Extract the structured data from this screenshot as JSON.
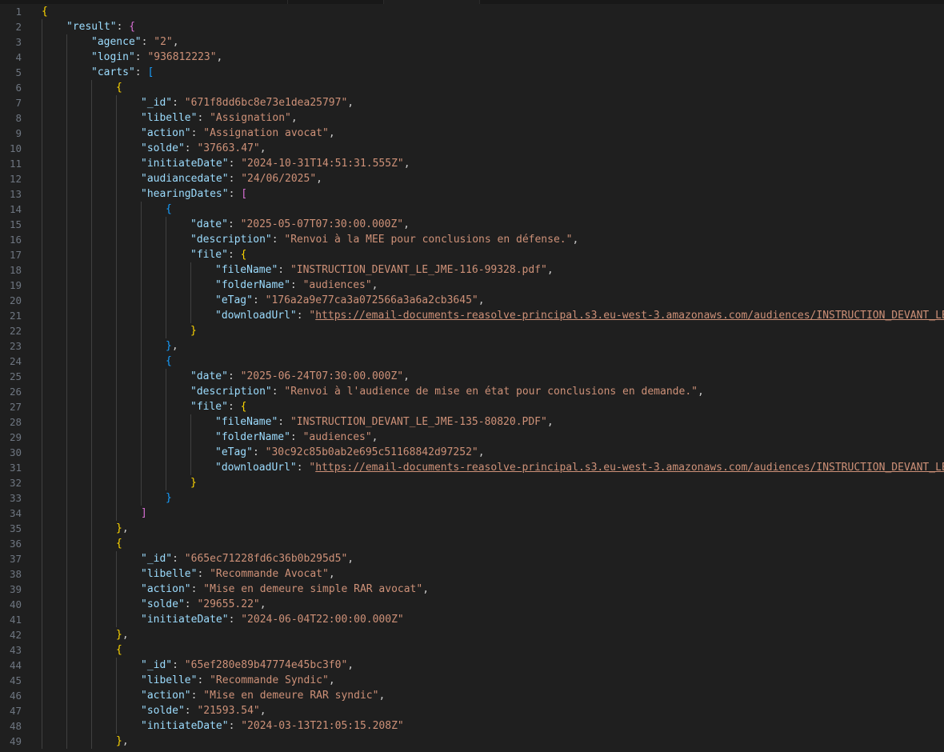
{
  "editor": {
    "language": "json",
    "colors": {
      "background": "#1f1f1f",
      "key": "#9cdcfe",
      "string": "#ce9178",
      "punctuation": "#cccccc",
      "line_number": "#6e7681",
      "bracket_level_1": "#ffd700",
      "bracket_level_2": "#da70d6",
      "bracket_level_3": "#179fff"
    },
    "lines": [
      {
        "n": "1",
        "d": 0,
        "t": [
          [
            "b1",
            "{"
          ]
        ]
      },
      {
        "n": "2",
        "d": 1,
        "t": [
          [
            "k",
            "\"result\""
          ],
          [
            "p",
            ": "
          ],
          [
            "b2",
            "{"
          ]
        ]
      },
      {
        "n": "3",
        "d": 2,
        "t": [
          [
            "k",
            "\"agence\""
          ],
          [
            "p",
            ": "
          ],
          [
            "s",
            "\"2\""
          ],
          [
            "p",
            ","
          ]
        ]
      },
      {
        "n": "4",
        "d": 2,
        "t": [
          [
            "k",
            "\"login\""
          ],
          [
            "p",
            ": "
          ],
          [
            "s",
            "\"936812223\""
          ],
          [
            "p",
            ","
          ]
        ]
      },
      {
        "n": "5",
        "d": 2,
        "t": [
          [
            "k",
            "\"carts\""
          ],
          [
            "p",
            ": "
          ],
          [
            "b3",
            "["
          ]
        ]
      },
      {
        "n": "6",
        "d": 3,
        "t": [
          [
            "b1",
            "{"
          ]
        ]
      },
      {
        "n": "7",
        "d": 4,
        "t": [
          [
            "k",
            "\"_id\""
          ],
          [
            "p",
            ": "
          ],
          [
            "s",
            "\"671f8dd6bc8e73e1dea25797\""
          ],
          [
            "p",
            ","
          ]
        ]
      },
      {
        "n": "8",
        "d": 4,
        "t": [
          [
            "k",
            "\"libelle\""
          ],
          [
            "p",
            ": "
          ],
          [
            "s",
            "\"Assignation\""
          ],
          [
            "p",
            ","
          ]
        ]
      },
      {
        "n": "9",
        "d": 4,
        "t": [
          [
            "k",
            "\"action\""
          ],
          [
            "p",
            ": "
          ],
          [
            "s",
            "\"Assignation avocat\""
          ],
          [
            "p",
            ","
          ]
        ]
      },
      {
        "n": "10",
        "d": 4,
        "t": [
          [
            "k",
            "\"solde\""
          ],
          [
            "p",
            ": "
          ],
          [
            "s",
            "\"37663.47\""
          ],
          [
            "p",
            ","
          ]
        ]
      },
      {
        "n": "11",
        "d": 4,
        "t": [
          [
            "k",
            "\"initiateDate\""
          ],
          [
            "p",
            ": "
          ],
          [
            "s",
            "\"2024-10-31T14:51:31.555Z\""
          ],
          [
            "p",
            ","
          ]
        ]
      },
      {
        "n": "12",
        "d": 4,
        "t": [
          [
            "k",
            "\"audiancedate\""
          ],
          [
            "p",
            ": "
          ],
          [
            "s",
            "\"24/06/2025\""
          ],
          [
            "p",
            ","
          ]
        ]
      },
      {
        "n": "13",
        "d": 4,
        "t": [
          [
            "k",
            "\"hearingDates\""
          ],
          [
            "p",
            ": "
          ],
          [
            "b2",
            "["
          ]
        ]
      },
      {
        "n": "14",
        "d": 5,
        "t": [
          [
            "b3",
            "{"
          ]
        ]
      },
      {
        "n": "15",
        "d": 6,
        "t": [
          [
            "k",
            "\"date\""
          ],
          [
            "p",
            ": "
          ],
          [
            "s",
            "\"2025-05-07T07:30:00.000Z\""
          ],
          [
            "p",
            ","
          ]
        ]
      },
      {
        "n": "16",
        "d": 6,
        "t": [
          [
            "k",
            "\"description\""
          ],
          [
            "p",
            ": "
          ],
          [
            "s",
            "\"Renvoi à la MEE pour conclusions en défense.\""
          ],
          [
            "p",
            ","
          ]
        ]
      },
      {
        "n": "17",
        "d": 6,
        "t": [
          [
            "k",
            "\"file\""
          ],
          [
            "p",
            ": "
          ],
          [
            "b1",
            "{"
          ]
        ]
      },
      {
        "n": "18",
        "d": 7,
        "t": [
          [
            "k",
            "\"fileName\""
          ],
          [
            "p",
            ": "
          ],
          [
            "s",
            "\"INSTRUCTION_DEVANT_LE_JME-116-99328.pdf\""
          ],
          [
            "p",
            ","
          ]
        ]
      },
      {
        "n": "19",
        "d": 7,
        "t": [
          [
            "k",
            "\"folderName\""
          ],
          [
            "p",
            ": "
          ],
          [
            "s",
            "\"audiences\""
          ],
          [
            "p",
            ","
          ]
        ]
      },
      {
        "n": "20",
        "d": 7,
        "t": [
          [
            "k",
            "\"eTag\""
          ],
          [
            "p",
            ": "
          ],
          [
            "s",
            "\"176a2a9e77ca3a072566a3a6a2cb3645\""
          ],
          [
            "p",
            ","
          ]
        ]
      },
      {
        "n": "21",
        "d": 7,
        "t": [
          [
            "k",
            "\"downloadUrl\""
          ],
          [
            "p",
            ": "
          ],
          [
            "s",
            "\""
          ],
          [
            "u",
            "https://email-documents-reasolve-principal.s3.eu-west-3.amazonaws.com/audiences/INSTRUCTION_DEVANT_LE_J"
          ]
        ]
      },
      {
        "n": "22",
        "d": 6,
        "t": [
          [
            "b1",
            "}"
          ]
        ]
      },
      {
        "n": "23",
        "d": 5,
        "t": [
          [
            "b3",
            "}"
          ],
          [
            "p",
            ","
          ]
        ]
      },
      {
        "n": "24",
        "d": 5,
        "t": [
          [
            "b3",
            "{"
          ]
        ]
      },
      {
        "n": "25",
        "d": 6,
        "t": [
          [
            "k",
            "\"date\""
          ],
          [
            "p",
            ": "
          ],
          [
            "s",
            "\"2025-06-24T07:30:00.000Z\""
          ],
          [
            "p",
            ","
          ]
        ]
      },
      {
        "n": "26",
        "d": 6,
        "t": [
          [
            "k",
            "\"description\""
          ],
          [
            "p",
            ": "
          ],
          [
            "s",
            "\"Renvoi à l'audience de mise en état pour conclusions en demande.\""
          ],
          [
            "p",
            ","
          ]
        ]
      },
      {
        "n": "27",
        "d": 6,
        "t": [
          [
            "k",
            "\"file\""
          ],
          [
            "p",
            ": "
          ],
          [
            "b1",
            "{"
          ]
        ]
      },
      {
        "n": "28",
        "d": 7,
        "t": [
          [
            "k",
            "\"fileName\""
          ],
          [
            "p",
            ": "
          ],
          [
            "s",
            "\"INSTRUCTION_DEVANT_LE_JME-135-80820.PDF\""
          ],
          [
            "p",
            ","
          ]
        ]
      },
      {
        "n": "29",
        "d": 7,
        "t": [
          [
            "k",
            "\"folderName\""
          ],
          [
            "p",
            ": "
          ],
          [
            "s",
            "\"audiences\""
          ],
          [
            "p",
            ","
          ]
        ]
      },
      {
        "n": "30",
        "d": 7,
        "t": [
          [
            "k",
            "\"eTag\""
          ],
          [
            "p",
            ": "
          ],
          [
            "s",
            "\"30c92c85b0ab2e695c51168842d97252\""
          ],
          [
            "p",
            ","
          ]
        ]
      },
      {
        "n": "31",
        "d": 7,
        "t": [
          [
            "k",
            "\"downloadUrl\""
          ],
          [
            "p",
            ": "
          ],
          [
            "s",
            "\""
          ],
          [
            "u",
            "https://email-documents-reasolve-principal.s3.eu-west-3.amazonaws.com/audiences/INSTRUCTION_DEVANT_LE_J"
          ]
        ]
      },
      {
        "n": "32",
        "d": 6,
        "t": [
          [
            "b1",
            "}"
          ]
        ]
      },
      {
        "n": "33",
        "d": 5,
        "t": [
          [
            "b3",
            "}"
          ]
        ]
      },
      {
        "n": "34",
        "d": 4,
        "t": [
          [
            "b2",
            "]"
          ]
        ]
      },
      {
        "n": "35",
        "d": 3,
        "t": [
          [
            "b1",
            "}"
          ],
          [
            "p",
            ","
          ]
        ]
      },
      {
        "n": "36",
        "d": 3,
        "t": [
          [
            "b1",
            "{"
          ]
        ]
      },
      {
        "n": "37",
        "d": 4,
        "t": [
          [
            "k",
            "\"_id\""
          ],
          [
            "p",
            ": "
          ],
          [
            "s",
            "\"665ec71228fd6c36b0b295d5\""
          ],
          [
            "p",
            ","
          ]
        ]
      },
      {
        "n": "38",
        "d": 4,
        "t": [
          [
            "k",
            "\"libelle\""
          ],
          [
            "p",
            ": "
          ],
          [
            "s",
            "\"Recommande Avocat\""
          ],
          [
            "p",
            ","
          ]
        ]
      },
      {
        "n": "39",
        "d": 4,
        "t": [
          [
            "k",
            "\"action\""
          ],
          [
            "p",
            ": "
          ],
          [
            "s",
            "\"Mise en demeure simple RAR avocat\""
          ],
          [
            "p",
            ","
          ]
        ]
      },
      {
        "n": "40",
        "d": 4,
        "t": [
          [
            "k",
            "\"solde\""
          ],
          [
            "p",
            ": "
          ],
          [
            "s",
            "\"29655.22\""
          ],
          [
            "p",
            ","
          ]
        ]
      },
      {
        "n": "41",
        "d": 4,
        "t": [
          [
            "k",
            "\"initiateDate\""
          ],
          [
            "p",
            ": "
          ],
          [
            "s",
            "\"2024-06-04T22:00:00.000Z\""
          ]
        ]
      },
      {
        "n": "42",
        "d": 3,
        "t": [
          [
            "b1",
            "}"
          ],
          [
            "p",
            ","
          ]
        ]
      },
      {
        "n": "43",
        "d": 3,
        "t": [
          [
            "b1",
            "{"
          ]
        ]
      },
      {
        "n": "44",
        "d": 4,
        "t": [
          [
            "k",
            "\"_id\""
          ],
          [
            "p",
            ": "
          ],
          [
            "s",
            "\"65ef280e89b47774e45bc3f0\""
          ],
          [
            "p",
            ","
          ]
        ]
      },
      {
        "n": "45",
        "d": 4,
        "t": [
          [
            "k",
            "\"libelle\""
          ],
          [
            "p",
            ": "
          ],
          [
            "s",
            "\"Recommande Syndic\""
          ],
          [
            "p",
            ","
          ]
        ]
      },
      {
        "n": "46",
        "d": 4,
        "t": [
          [
            "k",
            "\"action\""
          ],
          [
            "p",
            ": "
          ],
          [
            "s",
            "\"Mise en demeure RAR syndic\""
          ],
          [
            "p",
            ","
          ]
        ]
      },
      {
        "n": "47",
        "d": 4,
        "t": [
          [
            "k",
            "\"solde\""
          ],
          [
            "p",
            ": "
          ],
          [
            "s",
            "\"21593.54\""
          ],
          [
            "p",
            ","
          ]
        ]
      },
      {
        "n": "48",
        "d": 4,
        "t": [
          [
            "k",
            "\"initiateDate\""
          ],
          [
            "p",
            ": "
          ],
          [
            "s",
            "\"2024-03-13T21:05:15.208Z\""
          ]
        ]
      },
      {
        "n": "49",
        "d": 3,
        "t": [
          [
            "b1",
            "}"
          ],
          [
            "p",
            ","
          ]
        ]
      }
    ]
  }
}
